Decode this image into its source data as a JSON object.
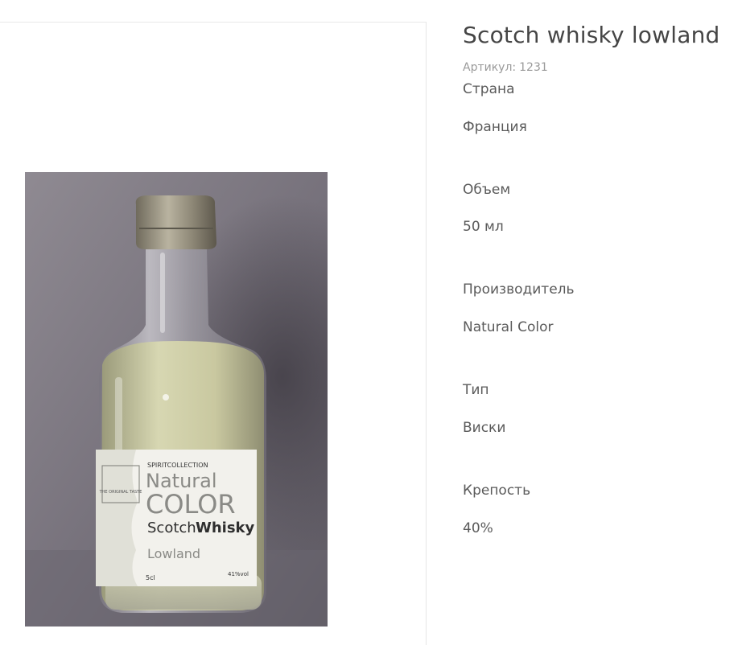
{
  "product": {
    "title": "Scotch whisky lowland",
    "sku_label": "Артикул:",
    "sku_value": "1231",
    "image_label_text": {
      "series": "SPIRITCOLLECTION",
      "brand_line1": "Natural",
      "brand_line2": "COLOR",
      "product_a": "Scotch",
      "product_b": "Whisky",
      "region": "Lowland",
      "badge": "THE ORIGINAL TASTE",
      "volume": "5cl",
      "abv": "41%vol"
    }
  },
  "properties": [
    {
      "label": "Страна",
      "value": "Франция"
    },
    {
      "label": "Объем",
      "value": "50 мл"
    },
    {
      "label": "Производитель",
      "value": "Natural Color"
    },
    {
      "label": "Тип",
      "value": "Виски"
    },
    {
      "label": "Крепость",
      "value": "40%"
    }
  ],
  "colors": {
    "text": "#5a5a5a",
    "muted": "#9a9a9a",
    "border": "#e6e6e6"
  }
}
